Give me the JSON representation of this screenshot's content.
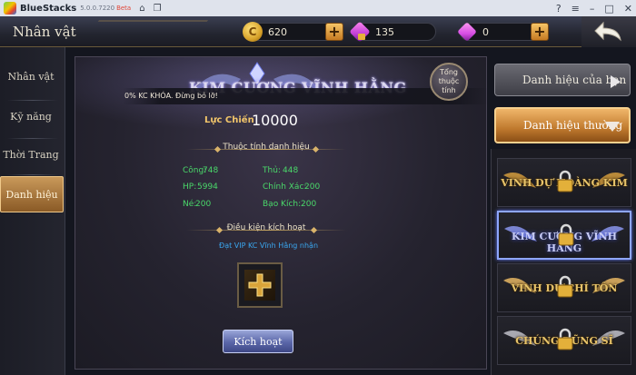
{
  "bluestacks": {
    "name": "BlueStacks",
    "version": "5.0.0.7220",
    "beta": "Beta"
  },
  "topbar": {
    "title": "Nhân vật",
    "gold": "620",
    "gem_locked": "135",
    "gem": "0"
  },
  "leftnav": {
    "items": [
      {
        "label": "Nhân vật"
      },
      {
        "label": "Kỹ năng"
      },
      {
        "label": "Thời Trang"
      },
      {
        "label": "Danh hiệu"
      }
    ]
  },
  "main": {
    "badge_title": "KIM CƯƠNG VĨNH HẰNG",
    "info_text": "0% KC KHÓA. Đừng bỏ lỡ!",
    "total_button": "Tổng thuộc tính",
    "combat_label": "Lực Chiến",
    "combat_value": "10000",
    "attr_section": "Thuộc tính danh hiệu",
    "stats": {
      "cong_label": "Công:",
      "cong_value": "748",
      "thu_label": "Thủ:",
      "thu_value": "448",
      "hp_label": "HP:",
      "hp_value": "5994",
      "chinhxac_label": "Chính Xác:",
      "chinhxac_value": "200",
      "ne_label": "Né:",
      "ne_value": "200",
      "baokich_label": "Bạo Kích:",
      "baokich_value": "200"
    },
    "cond_section": "Điều kiện kích hoạt",
    "cond_text": "Đạt VIP KC Vĩnh Hằng nhận",
    "activate_button": "Kích hoạt"
  },
  "right": {
    "your_titles": "Danh hiệu của bạn",
    "regular_titles": "Danh hiệu thường",
    "badges": [
      {
        "label": "VINH DỰ HOÀNG KIM"
      },
      {
        "label": "KIM CƯƠNG VĨNH HẰNG"
      },
      {
        "label": "VINH DỰ CHÍ TÔN"
      },
      {
        "label": "CHÚNG DŨNG SĨ"
      }
    ]
  },
  "colors": {
    "accent_gold": "#f2c66a",
    "stat_green": "#4ad86a",
    "link_blue": "#3aa7f0",
    "active_tab": "#c9995a"
  }
}
